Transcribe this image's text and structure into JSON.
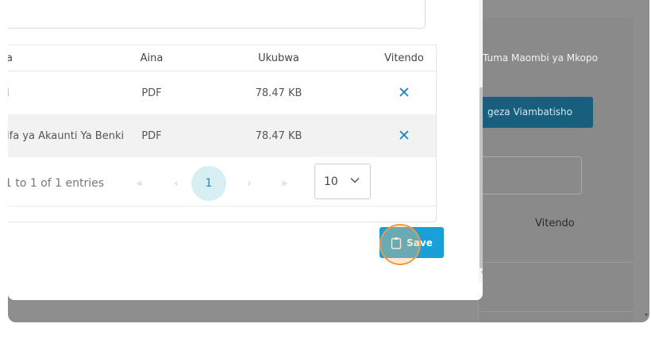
{
  "background": {
    "heading": "Tuma Maombi ya Mkopo",
    "attach_button": "geza Viambatisho",
    "column_actions": "Vitendo"
  },
  "table": {
    "headers": {
      "name": "a",
      "type": "Aina",
      "size": "Ukubwa",
      "actions": "Vitendo"
    },
    "rows": [
      {
        "name": "i",
        "type": "PDF",
        "size": "78.47 KB",
        "action_icon": "close-icon"
      },
      {
        "name": "ifa ya Akaunti Ya Benki",
        "type": "PDF",
        "size": "78.47 KB",
        "action_icon": "close-icon"
      }
    ]
  },
  "pagination": {
    "entries_text": "1 to 1 of 1 entries",
    "first": "«",
    "prev": "‹",
    "current_page": "1",
    "next": "›",
    "last": "»",
    "page_size": "10"
  },
  "save_button": {
    "label": "Save"
  },
  "colors": {
    "accent": "#1aa0d9",
    "delete_icon": "#1c86c4",
    "current_page_bg": "#d7eef2",
    "overlay": "#8e8e8e",
    "bg_button": "#175f7c"
  }
}
